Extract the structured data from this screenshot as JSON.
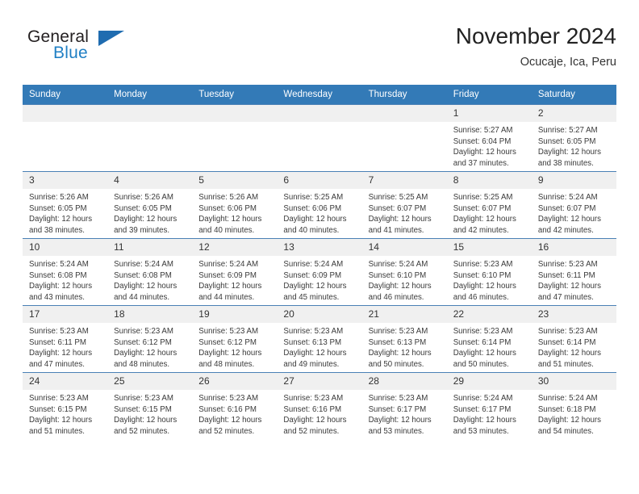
{
  "brand": {
    "word_top": "General",
    "word_bottom": "Blue",
    "triangle_icon": "triangle-icon"
  },
  "header": {
    "title": "November 2024",
    "location": "Ocucaje, Ica, Peru"
  },
  "weekday_headers": [
    "Sunday",
    "Monday",
    "Tuesday",
    "Wednesday",
    "Thursday",
    "Friday",
    "Saturday"
  ],
  "colors": {
    "header_blue": "#337ab7",
    "daynum_gray": "#f0f0f0",
    "brand_blue": "#1f7fc4",
    "grid_line": "#4a80b5"
  },
  "weeks": [
    [
      {
        "day": "",
        "lines": []
      },
      {
        "day": "",
        "lines": []
      },
      {
        "day": "",
        "lines": []
      },
      {
        "day": "",
        "lines": []
      },
      {
        "day": "",
        "lines": []
      },
      {
        "day": "1",
        "lines": [
          "Sunrise: 5:27 AM",
          "Sunset: 6:04 PM",
          "Daylight: 12 hours",
          "and 37 minutes."
        ]
      },
      {
        "day": "2",
        "lines": [
          "Sunrise: 5:27 AM",
          "Sunset: 6:05 PM",
          "Daylight: 12 hours",
          "and 38 minutes."
        ]
      }
    ],
    [
      {
        "day": "3",
        "lines": [
          "Sunrise: 5:26 AM",
          "Sunset: 6:05 PM",
          "Daylight: 12 hours",
          "and 38 minutes."
        ]
      },
      {
        "day": "4",
        "lines": [
          "Sunrise: 5:26 AM",
          "Sunset: 6:05 PM",
          "Daylight: 12 hours",
          "and 39 minutes."
        ]
      },
      {
        "day": "5",
        "lines": [
          "Sunrise: 5:26 AM",
          "Sunset: 6:06 PM",
          "Daylight: 12 hours",
          "and 40 minutes."
        ]
      },
      {
        "day": "6",
        "lines": [
          "Sunrise: 5:25 AM",
          "Sunset: 6:06 PM",
          "Daylight: 12 hours",
          "and 40 minutes."
        ]
      },
      {
        "day": "7",
        "lines": [
          "Sunrise: 5:25 AM",
          "Sunset: 6:07 PM",
          "Daylight: 12 hours",
          "and 41 minutes."
        ]
      },
      {
        "day": "8",
        "lines": [
          "Sunrise: 5:25 AM",
          "Sunset: 6:07 PM",
          "Daylight: 12 hours",
          "and 42 minutes."
        ]
      },
      {
        "day": "9",
        "lines": [
          "Sunrise: 5:24 AM",
          "Sunset: 6:07 PM",
          "Daylight: 12 hours",
          "and 42 minutes."
        ]
      }
    ],
    [
      {
        "day": "10",
        "lines": [
          "Sunrise: 5:24 AM",
          "Sunset: 6:08 PM",
          "Daylight: 12 hours",
          "and 43 minutes."
        ]
      },
      {
        "day": "11",
        "lines": [
          "Sunrise: 5:24 AM",
          "Sunset: 6:08 PM",
          "Daylight: 12 hours",
          "and 44 minutes."
        ]
      },
      {
        "day": "12",
        "lines": [
          "Sunrise: 5:24 AM",
          "Sunset: 6:09 PM",
          "Daylight: 12 hours",
          "and 44 minutes."
        ]
      },
      {
        "day": "13",
        "lines": [
          "Sunrise: 5:24 AM",
          "Sunset: 6:09 PM",
          "Daylight: 12 hours",
          "and 45 minutes."
        ]
      },
      {
        "day": "14",
        "lines": [
          "Sunrise: 5:24 AM",
          "Sunset: 6:10 PM",
          "Daylight: 12 hours",
          "and 46 minutes."
        ]
      },
      {
        "day": "15",
        "lines": [
          "Sunrise: 5:23 AM",
          "Sunset: 6:10 PM",
          "Daylight: 12 hours",
          "and 46 minutes."
        ]
      },
      {
        "day": "16",
        "lines": [
          "Sunrise: 5:23 AM",
          "Sunset: 6:11 PM",
          "Daylight: 12 hours",
          "and 47 minutes."
        ]
      }
    ],
    [
      {
        "day": "17",
        "lines": [
          "Sunrise: 5:23 AM",
          "Sunset: 6:11 PM",
          "Daylight: 12 hours",
          "and 47 minutes."
        ]
      },
      {
        "day": "18",
        "lines": [
          "Sunrise: 5:23 AM",
          "Sunset: 6:12 PM",
          "Daylight: 12 hours",
          "and 48 minutes."
        ]
      },
      {
        "day": "19",
        "lines": [
          "Sunrise: 5:23 AM",
          "Sunset: 6:12 PM",
          "Daylight: 12 hours",
          "and 48 minutes."
        ]
      },
      {
        "day": "20",
        "lines": [
          "Sunrise: 5:23 AM",
          "Sunset: 6:13 PM",
          "Daylight: 12 hours",
          "and 49 minutes."
        ]
      },
      {
        "day": "21",
        "lines": [
          "Sunrise: 5:23 AM",
          "Sunset: 6:13 PM",
          "Daylight: 12 hours",
          "and 50 minutes."
        ]
      },
      {
        "day": "22",
        "lines": [
          "Sunrise: 5:23 AM",
          "Sunset: 6:14 PM",
          "Daylight: 12 hours",
          "and 50 minutes."
        ]
      },
      {
        "day": "23",
        "lines": [
          "Sunrise: 5:23 AM",
          "Sunset: 6:14 PM",
          "Daylight: 12 hours",
          "and 51 minutes."
        ]
      }
    ],
    [
      {
        "day": "24",
        "lines": [
          "Sunrise: 5:23 AM",
          "Sunset: 6:15 PM",
          "Daylight: 12 hours",
          "and 51 minutes."
        ]
      },
      {
        "day": "25",
        "lines": [
          "Sunrise: 5:23 AM",
          "Sunset: 6:15 PM",
          "Daylight: 12 hours",
          "and 52 minutes."
        ]
      },
      {
        "day": "26",
        "lines": [
          "Sunrise: 5:23 AM",
          "Sunset: 6:16 PM",
          "Daylight: 12 hours",
          "and 52 minutes."
        ]
      },
      {
        "day": "27",
        "lines": [
          "Sunrise: 5:23 AM",
          "Sunset: 6:16 PM",
          "Daylight: 12 hours",
          "and 52 minutes."
        ]
      },
      {
        "day": "28",
        "lines": [
          "Sunrise: 5:23 AM",
          "Sunset: 6:17 PM",
          "Daylight: 12 hours",
          "and 53 minutes."
        ]
      },
      {
        "day": "29",
        "lines": [
          "Sunrise: 5:24 AM",
          "Sunset: 6:17 PM",
          "Daylight: 12 hours",
          "and 53 minutes."
        ]
      },
      {
        "day": "30",
        "lines": [
          "Sunrise: 5:24 AM",
          "Sunset: 6:18 PM",
          "Daylight: 12 hours",
          "and 54 minutes."
        ]
      }
    ]
  ]
}
